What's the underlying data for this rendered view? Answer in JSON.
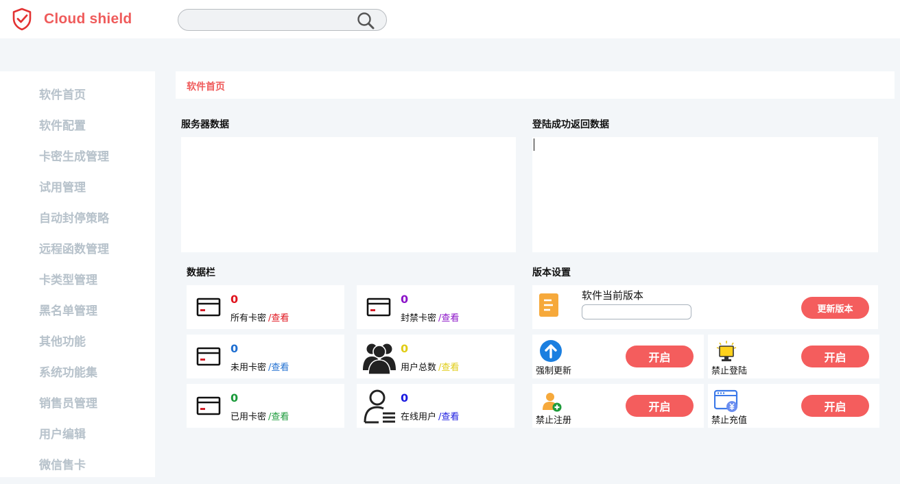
{
  "header": {
    "logo_text": "Cloud shield",
    "search": {
      "value": "",
      "placeholder": ""
    }
  },
  "sidebar": {
    "items": [
      "软件首页",
      "软件配置",
      "卡密生成管理",
      "试用管理",
      "自动封停策略",
      "远程函数管理",
      "卡类型管理",
      "黑名单管理",
      "其他功能",
      "系统功能集",
      "销售员管理",
      "用户编辑",
      "微信售卡"
    ]
  },
  "breadcrumb": "软件首页",
  "server_data": {
    "title": "服务器数据"
  },
  "login_data": {
    "title": "登陆成功返回数据"
  },
  "data_bar": {
    "title": "数据栏",
    "link_text": "/查看",
    "cards": [
      {
        "label": "所有卡密",
        "value": "0",
        "color": "#e0141e",
        "icon": "card-icon"
      },
      {
        "label": "封禁卡密",
        "value": "0",
        "color": "#8b13c8",
        "icon": "card-icon"
      },
      {
        "label": "未用卡密",
        "value": "0",
        "color": "#1f6fd1",
        "icon": "card-icon"
      },
      {
        "label": "用户总数",
        "value": "0",
        "color": "#e0cc16",
        "icon": "users-icon"
      },
      {
        "label": "已用卡密",
        "value": "0",
        "color": "#1a9a3a",
        "icon": "card-icon"
      },
      {
        "label": "在线用户",
        "value": "0",
        "color": "#1a1ae0",
        "icon": "online-user-icon"
      }
    ]
  },
  "version": {
    "title": "版本设置",
    "current_label": "软件当前版本",
    "input_value": "",
    "update_button": "更新版本",
    "toggles": [
      {
        "label": "强制更新",
        "button": "开启",
        "icon": "upload-arrow-icon"
      },
      {
        "label": "禁止登陆",
        "button": "开启",
        "icon": "monitor-icon"
      },
      {
        "label": "禁止注册",
        "button": "开启",
        "icon": "add-user-icon"
      },
      {
        "label": "禁止充值",
        "button": "开启",
        "icon": "payment-window-icon"
      }
    ]
  },
  "colors": {
    "accent": "#ef5b5b",
    "button": "#f45d5d",
    "sidebar_text": "#b7c2cb",
    "background": "#f3f6f9"
  }
}
